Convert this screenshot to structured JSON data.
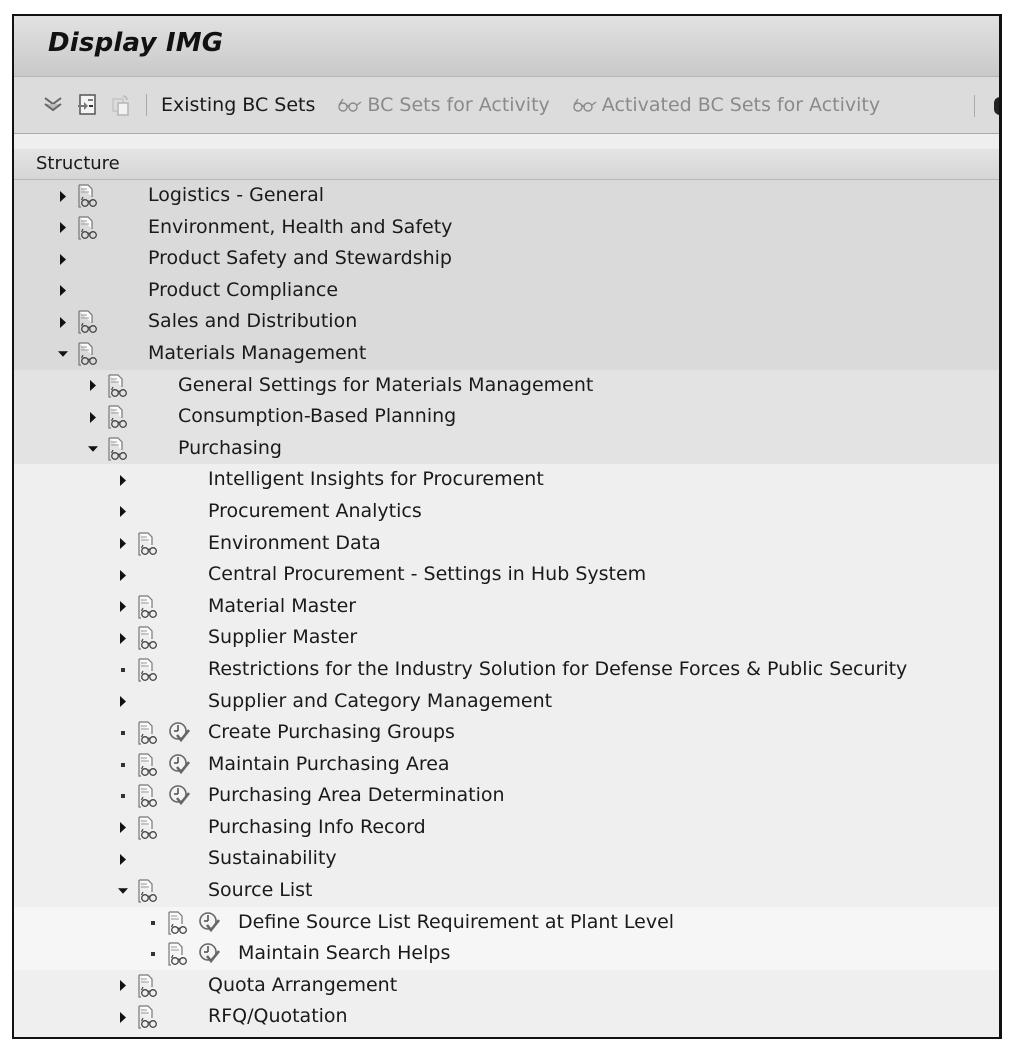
{
  "window": {
    "title": "Display IMG"
  },
  "toolbar": {
    "icons": [
      {
        "name": "expand-all-icon"
      },
      {
        "name": "expand-subtree-icon"
      },
      {
        "name": "collapse-icon",
        "disabled": true
      }
    ],
    "buttons": [
      {
        "label": "Existing BC Sets",
        "icon": null,
        "disabled": false
      },
      {
        "label": "BC Sets for Activity",
        "icon": "glasses-icon",
        "disabled": true
      },
      {
        "label": "Activated BC Sets for Activity",
        "icon": "glasses-icon",
        "disabled": true
      }
    ]
  },
  "structure": {
    "header": "Structure",
    "rows": [
      {
        "label": "Logistics - General",
        "level": 0,
        "node": "collapsed",
        "doc": true,
        "exec": false
      },
      {
        "label": "Environment, Health and Safety",
        "level": 0,
        "node": "collapsed",
        "doc": true,
        "exec": false
      },
      {
        "label": "Product Safety and Stewardship",
        "level": 0,
        "node": "collapsed",
        "doc": false,
        "exec": false
      },
      {
        "label": "Product Compliance",
        "level": 0,
        "node": "collapsed",
        "doc": false,
        "exec": false
      },
      {
        "label": "Sales and Distribution",
        "level": 0,
        "node": "collapsed",
        "doc": true,
        "exec": false
      },
      {
        "label": "Materials Management",
        "level": 0,
        "node": "expanded",
        "doc": true,
        "exec": false
      },
      {
        "label": "General Settings for Materials Management",
        "level": 1,
        "node": "collapsed",
        "doc": true,
        "exec": false
      },
      {
        "label": "Consumption-Based Planning",
        "level": 1,
        "node": "collapsed",
        "doc": true,
        "exec": false
      },
      {
        "label": "Purchasing",
        "level": 1,
        "node": "expanded",
        "doc": true,
        "exec": false
      },
      {
        "label": "Intelligent Insights for Procurement",
        "level": 2,
        "node": "collapsed",
        "doc": false,
        "exec": false
      },
      {
        "label": "Procurement Analytics",
        "level": 2,
        "node": "collapsed",
        "doc": false,
        "exec": false
      },
      {
        "label": "Environment Data",
        "level": 2,
        "node": "collapsed",
        "doc": true,
        "exec": false
      },
      {
        "label": "Central Procurement - Settings in Hub System",
        "level": 2,
        "node": "collapsed",
        "doc": false,
        "exec": false
      },
      {
        "label": "Material Master",
        "level": 2,
        "node": "collapsed",
        "doc": true,
        "exec": false
      },
      {
        "label": "Supplier Master",
        "level": 2,
        "node": "collapsed",
        "doc": true,
        "exec": false
      },
      {
        "label": "Restrictions for the Industry Solution for Defense Forces & Public Security",
        "level": 2,
        "node": "leaf",
        "doc": true,
        "exec": false
      },
      {
        "label": "Supplier and Category Management",
        "level": 2,
        "node": "collapsed",
        "doc": false,
        "exec": false
      },
      {
        "label": "Create Purchasing Groups",
        "level": 2,
        "node": "leaf",
        "doc": true,
        "exec": true
      },
      {
        "label": "Maintain Purchasing Area",
        "level": 2,
        "node": "leaf",
        "doc": true,
        "exec": true
      },
      {
        "label": "Purchasing Area Determination",
        "level": 2,
        "node": "leaf",
        "doc": true,
        "exec": true
      },
      {
        "label": "Purchasing Info Record",
        "level": 2,
        "node": "collapsed",
        "doc": true,
        "exec": false
      },
      {
        "label": "Sustainability",
        "level": 2,
        "node": "collapsed",
        "doc": false,
        "exec": false
      },
      {
        "label": "Source List",
        "level": 2,
        "node": "expanded",
        "doc": true,
        "exec": false
      },
      {
        "label": "Define Source List Requirement at Plant Level",
        "level": 3,
        "node": "leaf",
        "doc": true,
        "exec": true
      },
      {
        "label": "Maintain Search Helps",
        "level": 3,
        "node": "leaf",
        "doc": true,
        "exec": true
      },
      {
        "label": "Quota Arrangement",
        "level": 2,
        "node": "collapsed",
        "doc": true,
        "exec": false
      },
      {
        "label": "RFQ/Quotation",
        "level": 2,
        "node": "collapsed",
        "doc": true,
        "exec": false
      }
    ]
  }
}
